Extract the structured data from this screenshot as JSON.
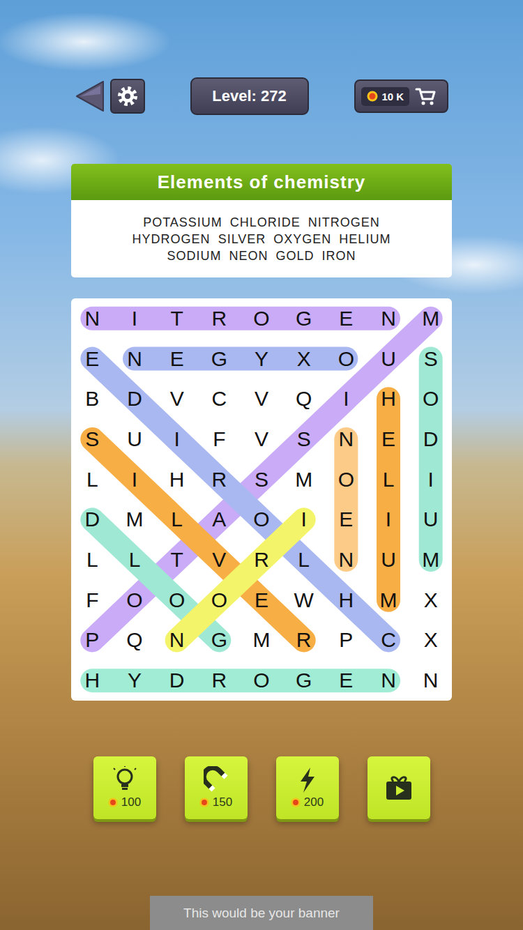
{
  "top_bar": {
    "level": "Level: 272",
    "coins": "10 K"
  },
  "category": {
    "title": "Elements of chemistry",
    "word_lines": [
      [
        "POTASSIUM",
        "CHLORIDE",
        "NITROGEN"
      ],
      [
        "HYDROGEN",
        "SILVER",
        "OXYGEN",
        "HELIUM"
      ],
      [
        "SODIUM",
        "NEON",
        "GOLD",
        "IRON"
      ]
    ]
  },
  "grid": {
    "rows": [
      [
        "N",
        "I",
        "T",
        "R",
        "O",
        "G",
        "E",
        "N",
        "M"
      ],
      [
        "E",
        "N",
        "E",
        "G",
        "Y",
        "X",
        "O",
        "U",
        "S"
      ],
      [
        "B",
        "D",
        "V",
        "C",
        "V",
        "Q",
        "I",
        "H",
        "O"
      ],
      [
        "S",
        "U",
        "I",
        "F",
        "V",
        "S",
        "N",
        "E",
        "D"
      ],
      [
        "L",
        "I",
        "H",
        "R",
        "S",
        "M",
        "O",
        "L",
        "I"
      ],
      [
        "D",
        "M",
        "L",
        "A",
        "O",
        "I",
        "E",
        "I",
        "U"
      ],
      [
        "L",
        "L",
        "T",
        "V",
        "R",
        "L",
        "N",
        "U",
        "M"
      ],
      [
        "F",
        "O",
        "O",
        "O",
        "E",
        "W",
        "H",
        "M",
        "X"
      ],
      [
        "P",
        "Q",
        "N",
        "G",
        "M",
        "R",
        "P",
        "C",
        "X"
      ],
      [
        "H",
        "Y",
        "D",
        "R",
        "O",
        "G",
        "E",
        "N",
        "N"
      ]
    ],
    "highlights": [
      {
        "from": [
          0,
          0
        ],
        "to": [
          0,
          7
        ],
        "color": "#c9abf7"
      },
      {
        "from": [
          1,
          1
        ],
        "to": [
          1,
          6
        ],
        "color": "#aab8f2"
      },
      {
        "from": [
          1,
          8
        ],
        "to": [
          6,
          8
        ],
        "color": "#9fe9d4"
      },
      {
        "from": [
          2,
          7
        ],
        "to": [
          7,
          7
        ],
        "color": "#f6ae45"
      },
      {
        "from": [
          3,
          6
        ],
        "to": [
          6,
          6
        ],
        "color": "#fccb88"
      },
      {
        "from": [
          9,
          0
        ],
        "to": [
          9,
          7
        ],
        "color": "#a0ecd5"
      },
      {
        "from": [
          8,
          0
        ],
        "to": [
          0,
          8
        ],
        "color": "#c9abf7"
      },
      {
        "from": [
          1,
          0
        ],
        "to": [
          8,
          7
        ],
        "color": "#aab8f2"
      },
      {
        "from": [
          3,
          0
        ],
        "to": [
          8,
          5
        ],
        "color": "#f6ae45"
      },
      {
        "from": [
          5,
          0
        ],
        "to": [
          8,
          3
        ],
        "color": "#9fe9d4"
      },
      {
        "from": [
          5,
          5
        ],
        "to": [
          8,
          2
        ],
        "color": "#f4f46a"
      }
    ]
  },
  "powerups": [
    {
      "kind": "hint",
      "price": "100"
    },
    {
      "kind": "magnet",
      "price": "150"
    },
    {
      "kind": "bolt",
      "price": "200"
    },
    {
      "kind": "video"
    }
  ],
  "banner": {
    "text": "This would be your banner"
  }
}
